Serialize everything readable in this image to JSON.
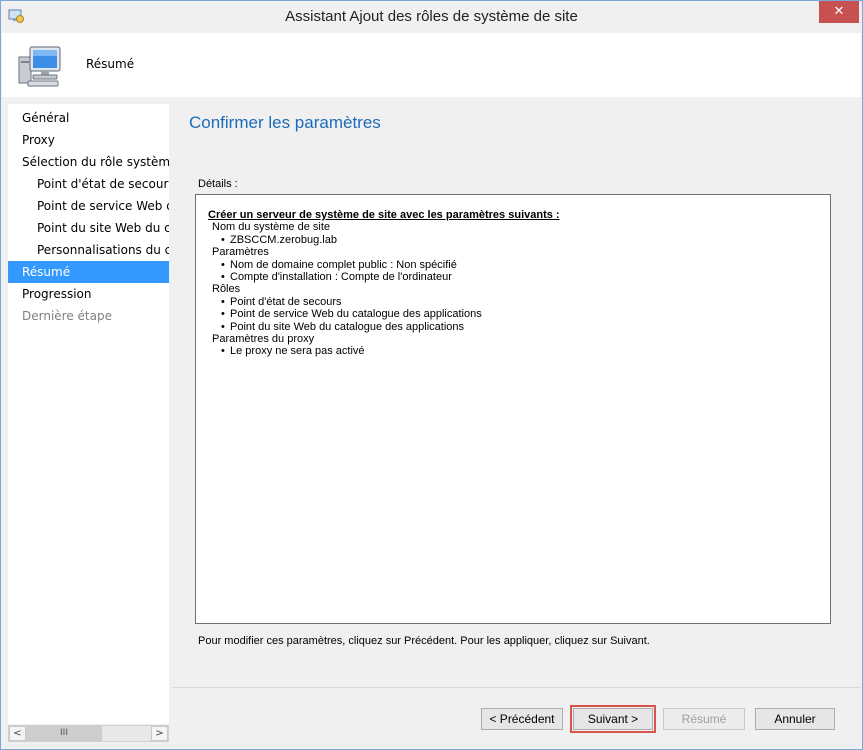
{
  "window": {
    "title": "Assistant Ajout des rôles de système de site",
    "close_label": "✕"
  },
  "header": {
    "title": "Résumé",
    "icon": "computer-icon"
  },
  "nav": {
    "items": [
      {
        "label": "Général",
        "level": 0,
        "state": "normal"
      },
      {
        "label": "Proxy",
        "level": 0,
        "state": "normal"
      },
      {
        "label": "Sélection du rôle système",
        "level": 0,
        "state": "normal"
      },
      {
        "label": "Point d'état de secours",
        "level": 1,
        "state": "normal"
      },
      {
        "label": "Point de service Web du catalogue des applications",
        "level": 1,
        "state": "normal"
      },
      {
        "label": "Point du site Web du catalogue des applications",
        "level": 1,
        "state": "normal"
      },
      {
        "label": "Personnalisations du catalogue des applications",
        "level": 1,
        "state": "normal"
      },
      {
        "label": "Résumé",
        "level": 0,
        "state": "selected"
      },
      {
        "label": "Progression",
        "level": 0,
        "state": "normal"
      },
      {
        "label": "Dernière étape",
        "level": 0,
        "state": "disabled"
      }
    ],
    "scroll_thumb_label": "III",
    "scroll_left": "<",
    "scroll_right": ">"
  },
  "main": {
    "page_title": "Confirmer les paramètres",
    "details_label": "Détails :",
    "details": {
      "heading": "Créer un serveur de système de site avec les paramètres suivants :",
      "sections": [
        {
          "title": "Nom du système de site",
          "items": [
            "ZBSCCM.zerobug.lab"
          ]
        },
        {
          "title": "Paramètres",
          "items": [
            "Nom de domaine complet public : Non spécifié",
            "Compte d'installation : Compte de l'ordinateur"
          ]
        },
        {
          "title": "Rôles",
          "items": [
            "Point d'état de secours",
            "Point de service Web du catalogue des applications",
            "Point du site Web du catalogue des applications"
          ]
        },
        {
          "title": "Paramètres du proxy",
          "items": [
            "Le proxy ne sera pas activé"
          ]
        }
      ]
    },
    "hint": "Pour modifier ces paramètres, cliquez sur Précédent. Pour les appliquer, cliquez sur Suivant."
  },
  "buttons": {
    "previous": "< Précédent",
    "next": "Suivant >",
    "summary": "Résumé",
    "cancel": "Annuler"
  },
  "colors": {
    "accent": "#1e6bb8",
    "selection": "#3399ff",
    "close": "#c75050",
    "focus_outline": "#d9534f"
  }
}
